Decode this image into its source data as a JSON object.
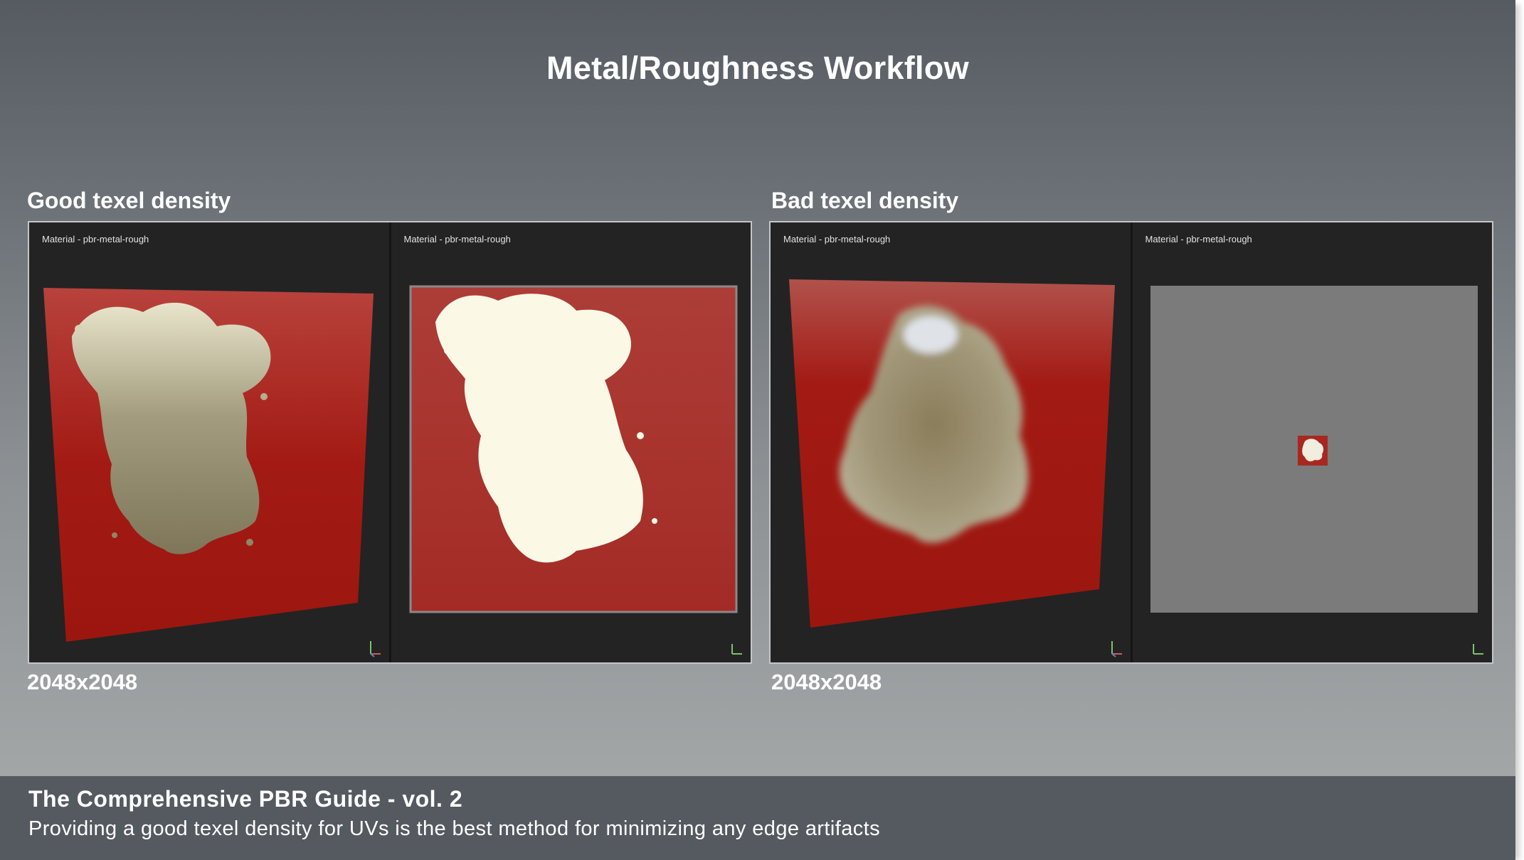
{
  "slide": {
    "title": "Metal/Roughness Workflow"
  },
  "panels": [
    {
      "heading": "Good texel density",
      "caption": "2048x2048",
      "views": [
        {
          "label": "Material - pbr-metal-rough"
        },
        {
          "label": "Material - pbr-metal-rough"
        }
      ]
    },
    {
      "heading": "Bad texel density",
      "caption": "2048x2048",
      "views": [
        {
          "label": "Material - pbr-metal-rough"
        },
        {
          "label": "Material - pbr-metal-rough"
        }
      ]
    }
  ],
  "footer": {
    "title": "The Comprehensive PBR Guide - vol. 2",
    "subtitle": "Providing a good texel density for UVs is the best method for minimizing any edge artifacts"
  },
  "colors": {
    "red_material": "#a31a14",
    "gold_metal": "#bfb58f",
    "viewport_bg": "#232323",
    "uv_grey": "#7b7b7b"
  },
  "icons": [
    "axis-gizmo-icon"
  ]
}
